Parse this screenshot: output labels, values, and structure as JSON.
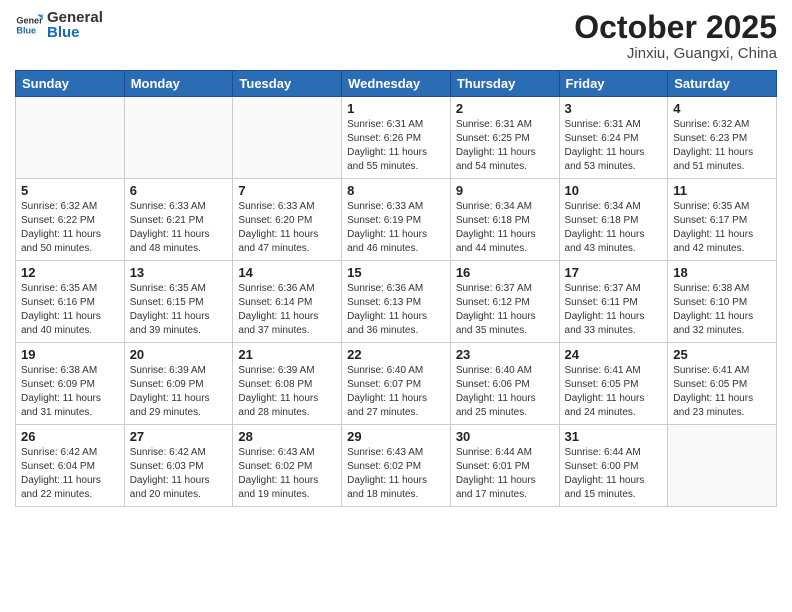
{
  "logo": {
    "general": "General",
    "blue": "Blue"
  },
  "header": {
    "month": "October 2025",
    "location": "Jinxiu, Guangxi, China"
  },
  "days_of_week": [
    "Sunday",
    "Monday",
    "Tuesday",
    "Wednesday",
    "Thursday",
    "Friday",
    "Saturday"
  ],
  "weeks": [
    [
      {
        "day": "",
        "info": ""
      },
      {
        "day": "",
        "info": ""
      },
      {
        "day": "",
        "info": ""
      },
      {
        "day": "1",
        "info": "Sunrise: 6:31 AM\nSunset: 6:26 PM\nDaylight: 11 hours\nand 55 minutes."
      },
      {
        "day": "2",
        "info": "Sunrise: 6:31 AM\nSunset: 6:25 PM\nDaylight: 11 hours\nand 54 minutes."
      },
      {
        "day": "3",
        "info": "Sunrise: 6:31 AM\nSunset: 6:24 PM\nDaylight: 11 hours\nand 53 minutes."
      },
      {
        "day": "4",
        "info": "Sunrise: 6:32 AM\nSunset: 6:23 PM\nDaylight: 11 hours\nand 51 minutes."
      }
    ],
    [
      {
        "day": "5",
        "info": "Sunrise: 6:32 AM\nSunset: 6:22 PM\nDaylight: 11 hours\nand 50 minutes."
      },
      {
        "day": "6",
        "info": "Sunrise: 6:33 AM\nSunset: 6:21 PM\nDaylight: 11 hours\nand 48 minutes."
      },
      {
        "day": "7",
        "info": "Sunrise: 6:33 AM\nSunset: 6:20 PM\nDaylight: 11 hours\nand 47 minutes."
      },
      {
        "day": "8",
        "info": "Sunrise: 6:33 AM\nSunset: 6:19 PM\nDaylight: 11 hours\nand 46 minutes."
      },
      {
        "day": "9",
        "info": "Sunrise: 6:34 AM\nSunset: 6:18 PM\nDaylight: 11 hours\nand 44 minutes."
      },
      {
        "day": "10",
        "info": "Sunrise: 6:34 AM\nSunset: 6:18 PM\nDaylight: 11 hours\nand 43 minutes."
      },
      {
        "day": "11",
        "info": "Sunrise: 6:35 AM\nSunset: 6:17 PM\nDaylight: 11 hours\nand 42 minutes."
      }
    ],
    [
      {
        "day": "12",
        "info": "Sunrise: 6:35 AM\nSunset: 6:16 PM\nDaylight: 11 hours\nand 40 minutes."
      },
      {
        "day": "13",
        "info": "Sunrise: 6:35 AM\nSunset: 6:15 PM\nDaylight: 11 hours\nand 39 minutes."
      },
      {
        "day": "14",
        "info": "Sunrise: 6:36 AM\nSunset: 6:14 PM\nDaylight: 11 hours\nand 37 minutes."
      },
      {
        "day": "15",
        "info": "Sunrise: 6:36 AM\nSunset: 6:13 PM\nDaylight: 11 hours\nand 36 minutes."
      },
      {
        "day": "16",
        "info": "Sunrise: 6:37 AM\nSunset: 6:12 PM\nDaylight: 11 hours\nand 35 minutes."
      },
      {
        "day": "17",
        "info": "Sunrise: 6:37 AM\nSunset: 6:11 PM\nDaylight: 11 hours\nand 33 minutes."
      },
      {
        "day": "18",
        "info": "Sunrise: 6:38 AM\nSunset: 6:10 PM\nDaylight: 11 hours\nand 32 minutes."
      }
    ],
    [
      {
        "day": "19",
        "info": "Sunrise: 6:38 AM\nSunset: 6:09 PM\nDaylight: 11 hours\nand 31 minutes."
      },
      {
        "day": "20",
        "info": "Sunrise: 6:39 AM\nSunset: 6:09 PM\nDaylight: 11 hours\nand 29 minutes."
      },
      {
        "day": "21",
        "info": "Sunrise: 6:39 AM\nSunset: 6:08 PM\nDaylight: 11 hours\nand 28 minutes."
      },
      {
        "day": "22",
        "info": "Sunrise: 6:40 AM\nSunset: 6:07 PM\nDaylight: 11 hours\nand 27 minutes."
      },
      {
        "day": "23",
        "info": "Sunrise: 6:40 AM\nSunset: 6:06 PM\nDaylight: 11 hours\nand 25 minutes."
      },
      {
        "day": "24",
        "info": "Sunrise: 6:41 AM\nSunset: 6:05 PM\nDaylight: 11 hours\nand 24 minutes."
      },
      {
        "day": "25",
        "info": "Sunrise: 6:41 AM\nSunset: 6:05 PM\nDaylight: 11 hours\nand 23 minutes."
      }
    ],
    [
      {
        "day": "26",
        "info": "Sunrise: 6:42 AM\nSunset: 6:04 PM\nDaylight: 11 hours\nand 22 minutes."
      },
      {
        "day": "27",
        "info": "Sunrise: 6:42 AM\nSunset: 6:03 PM\nDaylight: 11 hours\nand 20 minutes."
      },
      {
        "day": "28",
        "info": "Sunrise: 6:43 AM\nSunset: 6:02 PM\nDaylight: 11 hours\nand 19 minutes."
      },
      {
        "day": "29",
        "info": "Sunrise: 6:43 AM\nSunset: 6:02 PM\nDaylight: 11 hours\nand 18 minutes."
      },
      {
        "day": "30",
        "info": "Sunrise: 6:44 AM\nSunset: 6:01 PM\nDaylight: 11 hours\nand 17 minutes."
      },
      {
        "day": "31",
        "info": "Sunrise: 6:44 AM\nSunset: 6:00 PM\nDaylight: 11 hours\nand 15 minutes."
      },
      {
        "day": "",
        "info": ""
      }
    ]
  ]
}
